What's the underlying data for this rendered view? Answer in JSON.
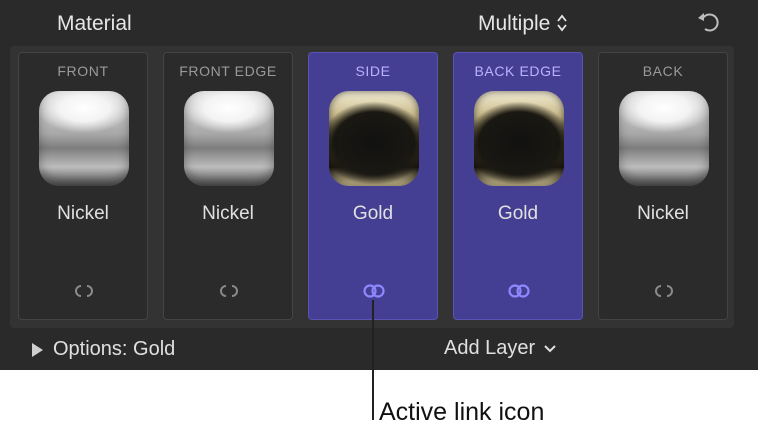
{
  "header": {
    "title": "Material",
    "mode": "Multiple"
  },
  "tiles": [
    {
      "label": "FRONT",
      "material": "Nickel",
      "linked": false,
      "selected": false
    },
    {
      "label": "FRONT EDGE",
      "material": "Nickel",
      "linked": false,
      "selected": false
    },
    {
      "label": "SIDE",
      "material": "Gold",
      "linked": true,
      "selected": true
    },
    {
      "label": "BACK EDGE",
      "material": "Gold",
      "linked": true,
      "selected": true
    },
    {
      "label": "BACK",
      "material": "Nickel",
      "linked": false,
      "selected": false
    }
  ],
  "footer": {
    "options_label": "Options: Gold",
    "add_layer_label": "Add Layer"
  },
  "callout": {
    "text": "Active link icon"
  },
  "colors": {
    "panel_bg": "#2a2a2a",
    "selected_tile_bg": "#453f93",
    "active_link": "#8f87ff",
    "inactive_link": "#8a8a8a"
  },
  "icons": {
    "reset": "reset-icon",
    "updown": "chevron-updown-icon",
    "disclosure": "disclosure-triangle-icon",
    "dropdown": "chevron-down-icon",
    "link_active": "link-active-icon",
    "link_inactive": "link-inactive-icon"
  }
}
